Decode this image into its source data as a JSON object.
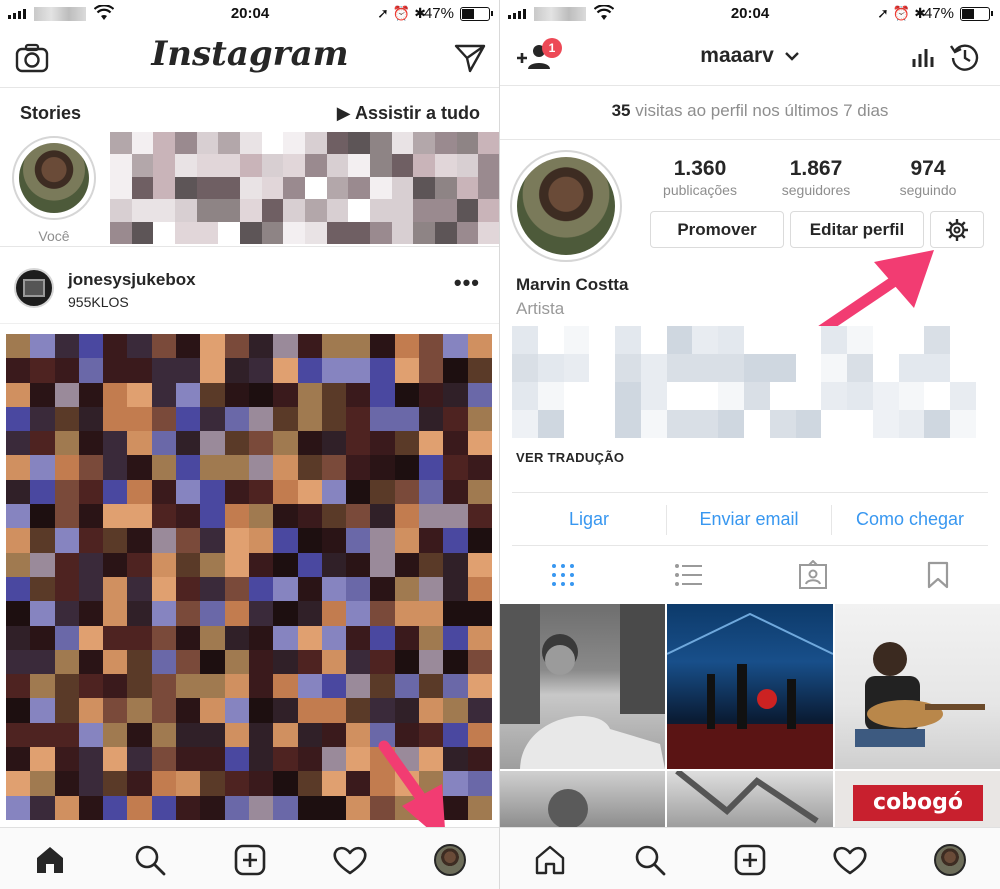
{
  "status_bar": {
    "time": "20:04",
    "battery": "47%",
    "battery_level": 0.47
  },
  "feed": {
    "logo": "Instagram",
    "stories": {
      "title": "Stories",
      "watch_all": "▶ Assistir a tudo",
      "you_label": "Você"
    },
    "post": {
      "username": "jonesysjukebox",
      "location": "955KLOS",
      "more": "•••"
    }
  },
  "profile": {
    "username": "maaarv",
    "notification_badge": "1",
    "visits_count": "35",
    "visits_text": " visitas ao perfil nos últimos 7 dias",
    "stats": [
      {
        "value": "1.360",
        "label": "publicações"
      },
      {
        "value": "1.867",
        "label": "seguidores"
      },
      {
        "value": "974",
        "label": "seguindo"
      }
    ],
    "buttons": {
      "promote": "Promover",
      "edit_profile": "Editar perfil"
    },
    "full_name": "Marvin Costta",
    "category": "Artista",
    "see_translation": "VER TRADUÇÃO",
    "contacts": [
      "Ligar",
      "Enviar email",
      "Como chegar"
    ],
    "grid_photos": {
      "banner_text": "cobogó"
    }
  },
  "colors": {
    "accent_link": "#3897f0",
    "badge": "#ed4956",
    "arrow": "#f23c72",
    "text": "#262626",
    "muted": "#8e8e8e"
  },
  "icons": {
    "left_header_left": "camera-icon",
    "left_header_right": "direct-send-icon",
    "right_header_left": "add-person-icon",
    "right_header_right_1": "insights-icon",
    "right_header_right_2": "archive-history-icon",
    "nav": [
      "home-icon",
      "search-icon",
      "new-post-icon",
      "activity-heart-icon",
      "profile-avatar"
    ],
    "tabs": [
      "grid-view-icon",
      "list-view-icon",
      "tagged-icon",
      "saved-icon"
    ]
  }
}
